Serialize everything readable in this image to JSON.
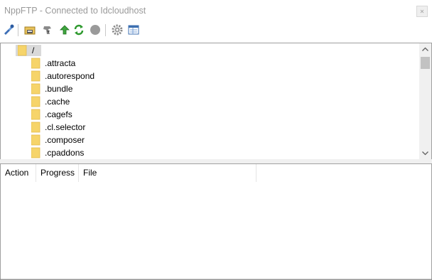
{
  "window": {
    "title": "NppFTP - Connected to Idcloudhost"
  },
  "toolbar": {
    "buttons": [
      {
        "name": "connect-icon"
      },
      {
        "name": "open-directory-icon"
      },
      {
        "name": "download-icon"
      },
      {
        "name": "upload-icon"
      },
      {
        "name": "refresh-icon"
      },
      {
        "name": "abort-icon"
      },
      {
        "name": "settings-icon"
      },
      {
        "name": "message-window-icon"
      }
    ]
  },
  "tree": {
    "root": {
      "label": "/"
    },
    "items": [
      {
        "label": ".attracta"
      },
      {
        "label": ".autorespond"
      },
      {
        "label": ".bundle"
      },
      {
        "label": ".cache"
      },
      {
        "label": ".cagefs"
      },
      {
        "label": ".cl.selector"
      },
      {
        "label": ".composer"
      },
      {
        "label": ".cpaddons"
      }
    ]
  },
  "queue": {
    "columns": [
      {
        "label": "Action"
      },
      {
        "label": "Progress"
      },
      {
        "label": "File"
      }
    ]
  },
  "colors": {
    "folder": "#f6d46a",
    "title": "#9a9a9a",
    "border": "#a0a0a0"
  }
}
